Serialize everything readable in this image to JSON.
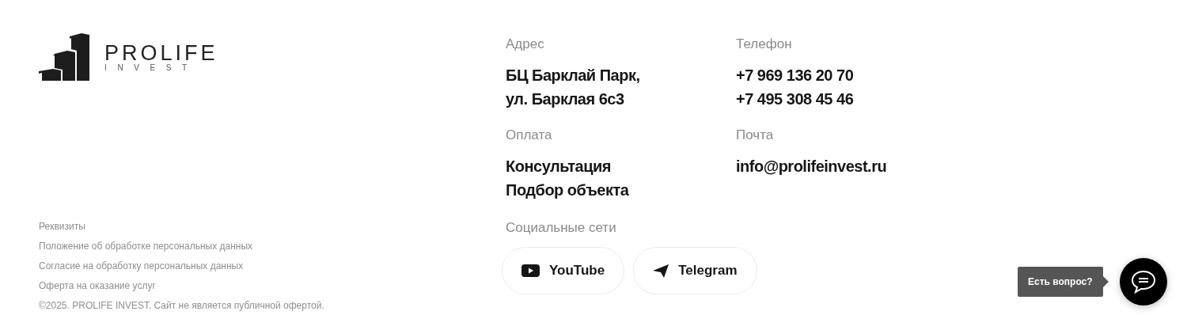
{
  "logo": {
    "name": "PROLIFE",
    "tagline": "INVEST"
  },
  "contacts": [
    {
      "label": "Адрес",
      "lines": [
        "БЦ Барклай Парк,",
        "ул. Барклая 6с3"
      ]
    },
    {
      "label": "Телефон",
      "lines": [
        "+7 969 136 20 70",
        "+7 495 308 45 46"
      ]
    },
    {
      "label": "Оплата",
      "lines": [
        "Консультация",
        "Подбор объекта"
      ]
    },
    {
      "label": "Почта",
      "lines": [
        "info@prolifeinvest.ru"
      ]
    }
  ],
  "social": {
    "label": "Социальные сети",
    "buttons": [
      {
        "label": "YouTube",
        "kind": "youtube"
      },
      {
        "label": "Telegram",
        "kind": "telegram"
      }
    ]
  },
  "legal_links": [
    "Реквизиты",
    "Положение об обработке персональных данных",
    "Согласие на обработку персональных данных",
    "Оферта на оказание услуг"
  ],
  "copyright": "©2025. PROLIFE INVEST. Сайт не является публичной офертой.",
  "chat": {
    "tooltip": "Есть вопрос?"
  }
}
